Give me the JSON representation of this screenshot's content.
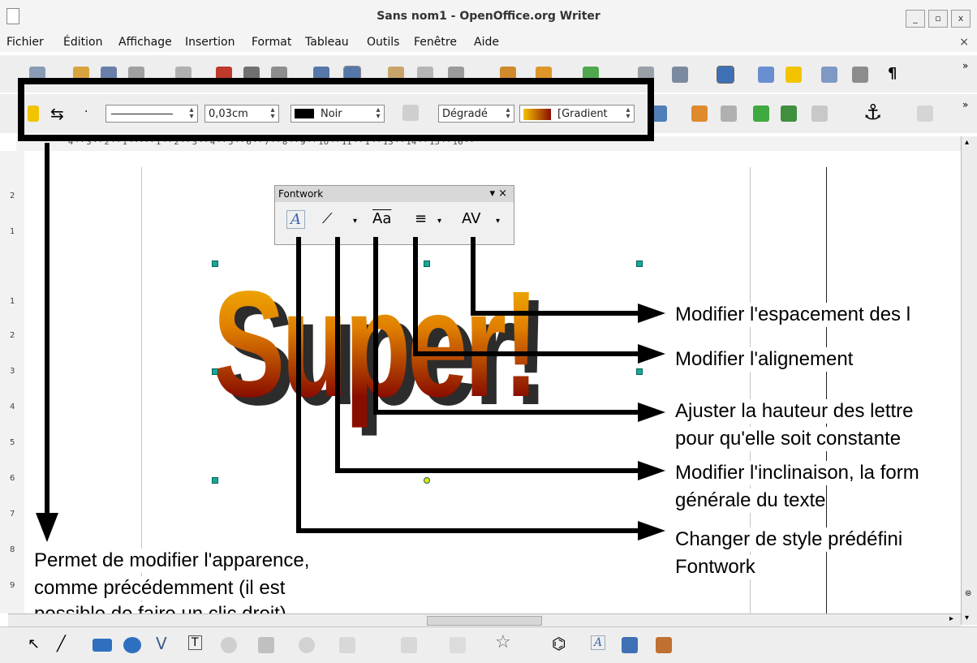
{
  "window": {
    "title": "Sans nom1 - OpenOffice.org Writer",
    "buttons": [
      "_",
      "▫",
      "x"
    ]
  },
  "menu": {
    "items": [
      "Fichier",
      "Édition",
      "Affichage",
      "Insertion",
      "Format",
      "Tableau",
      "Outils",
      "Fenêtre",
      "Aide"
    ],
    "close": "×"
  },
  "toolbar2": {
    "line_width": "0,03cm",
    "line_color": "Noir",
    "fill_type": "Dégradé",
    "fill_value": "[Gradient"
  },
  "ruler": {
    "marks": "4 · · 3 · · 2 · · 1 · · ·   · · 1 · · 2 · · 3 · · 4 · · 5 · · 6 · · 7 · · 8 · · 9 · · 10 · · 11 · · 1 · · 13 · · 14 · · 15 · · 16 · ·"
  },
  "vruler": [
    "2",
    "1",
    "1",
    "2",
    "3",
    "4",
    "5",
    "6",
    "7",
    "8",
    "9"
  ],
  "fontwork": {
    "title": "Fontwork",
    "close": "▾ ×",
    "btn_style": "A",
    "btn_shape": "⟋",
    "btn_height": "Aa",
    "btn_align": "≡",
    "btn_spacing": "AV"
  },
  "document": {
    "fontwork_text": "Super!"
  },
  "callouts": {
    "spacing": "Modifier l'espacement des l",
    "align": "Modifier l'alignement",
    "height_1": "Ajuster la hauteur des lettre",
    "height_2": "pour qu'elle soit constante",
    "shape_1": "Modifier l'inclinaison, la form",
    "shape_2": "générale du texte",
    "style_1": "Changer de style prédéfini",
    "style_2": "Fontwork",
    "appearance_1": "Permet de modifier l'apparence,",
    "appearance_2": "comme précédemment (il est",
    "appearance_3": "possible de faire un clic droit)"
  },
  "colors": {
    "accent_gradient_top": "#f6c200",
    "accent_gradient_bottom": "#8a0e00",
    "highlight_box": "#000000"
  }
}
